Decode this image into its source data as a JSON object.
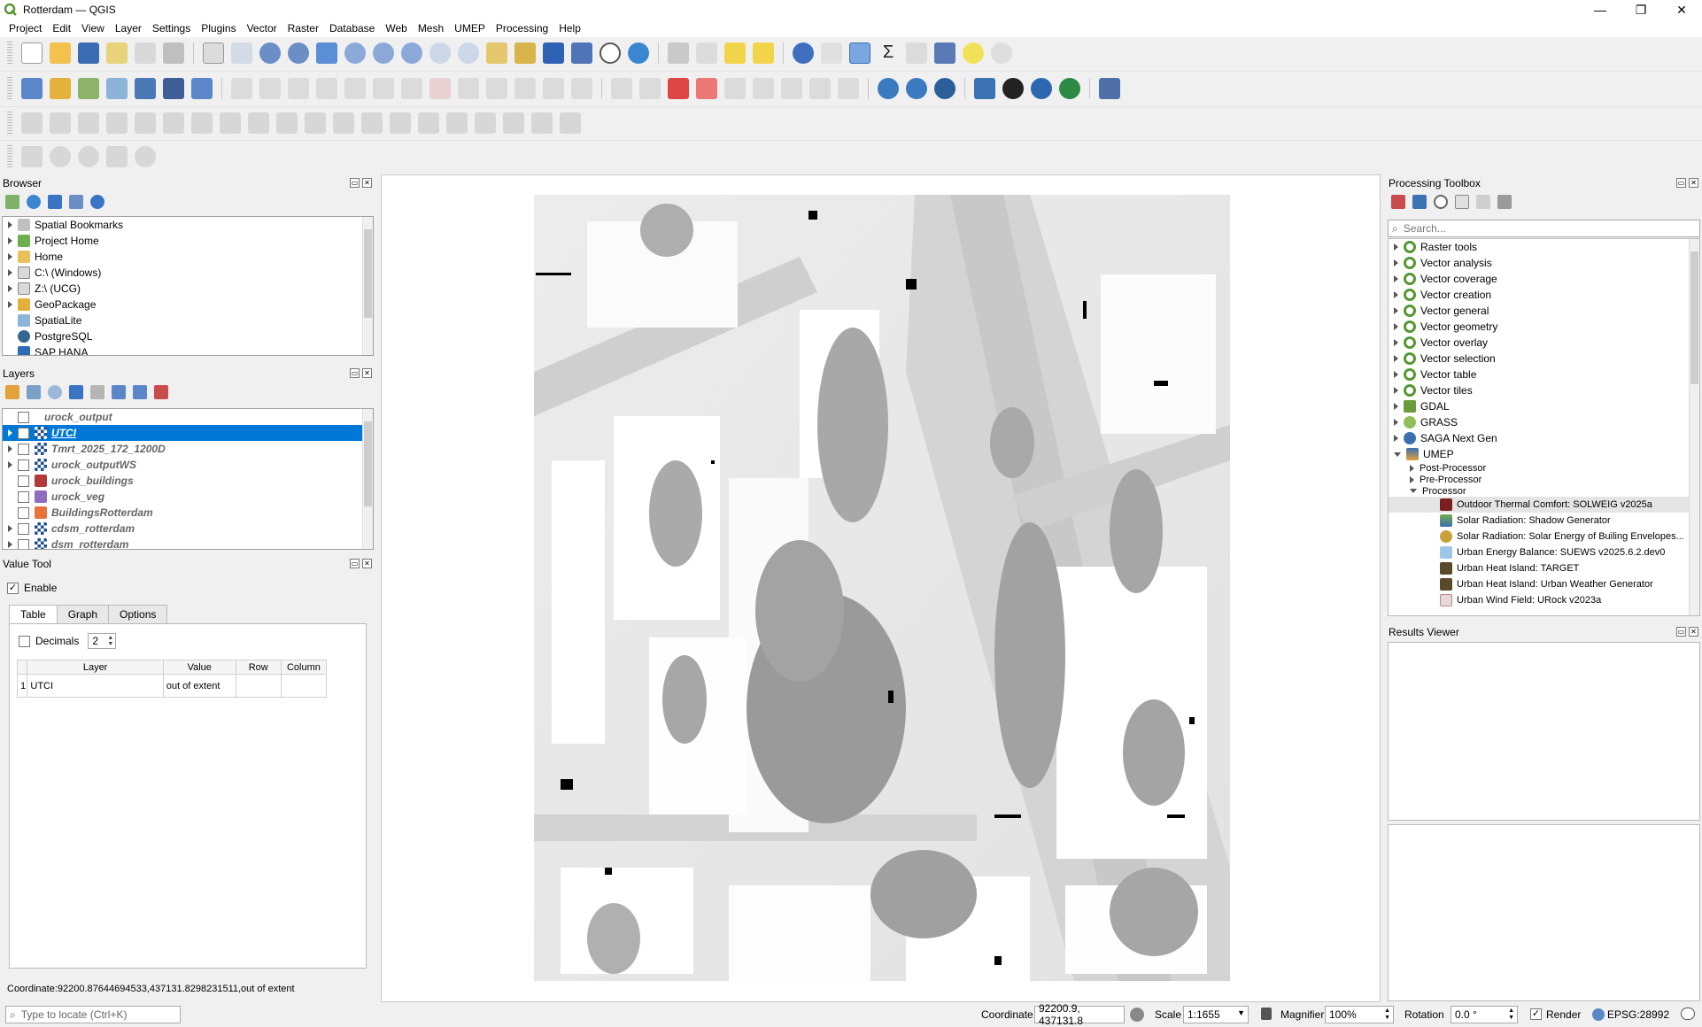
{
  "window": {
    "title": "Rotterdam — QGIS",
    "minimize": "—",
    "maximize": "❐",
    "close": "✕"
  },
  "menu": [
    "Project",
    "Edit",
    "View",
    "Layer",
    "Settings",
    "Plugins",
    "Vector",
    "Raster",
    "Database",
    "Web",
    "Mesh",
    "UMEP",
    "Processing",
    "Help"
  ],
  "browser": {
    "title": "Browser",
    "items": [
      "Spatial Bookmarks",
      "Project Home",
      "Home",
      "C:\\ (Windows)",
      "Z:\\ (UCG)",
      "GeoPackage",
      "SpatiaLite",
      "PostgreSQL",
      "SAP HANA"
    ]
  },
  "layers": {
    "title": "Layers",
    "items": [
      "urock_output",
      "UTCI",
      "Tmrt_2025_172_1200D",
      "urock_outputWS",
      "urock_buildings",
      "urock_veg",
      "BuildingsRotterdam",
      "cdsm_rotterdam",
      "dsm_rotterdam"
    ]
  },
  "value_tool": {
    "title": "Value Tool",
    "enable_label": "Enable",
    "tabs": [
      "Table",
      "Graph",
      "Options"
    ],
    "decimals_label": "Decimals",
    "decimals_value": "2",
    "columns": [
      "Layer",
      "Value",
      "Row",
      "Column"
    ],
    "row_index": "1",
    "row_layer": "UTCI",
    "row_value": "out of extent",
    "coordinate_readout": "Coordinate:92200.87644694533,437131.8298231511,out of extent"
  },
  "processing": {
    "title": "Processing Toolbox",
    "search_placeholder": "Search...",
    "groups": [
      "Raster tools",
      "Vector analysis",
      "Vector coverage",
      "Vector creation",
      "Vector general",
      "Vector geometry",
      "Vector overlay",
      "Vector selection",
      "Vector table",
      "Vector tiles",
      "GDAL",
      "GRASS",
      "SAGA Next Gen",
      "UMEP"
    ],
    "umep_children": [
      "Post-Processor",
      "Pre-Processor",
      "Processor"
    ],
    "processor_tools": [
      "Outdoor Thermal Comfort: SOLWEIG v2025a",
      "Solar Radiation: Shadow Generator",
      "Solar Radiation: Solar Energy of Builing Envelopes...",
      "Urban Energy Balance: SUEWS v2025.6.2.dev0",
      "Urban Heat Island: TARGET",
      "Urban Heat Island: Urban Weather Generator",
      "Urban Wind Field: URock v2023a"
    ]
  },
  "results_viewer": {
    "title": "Results Viewer"
  },
  "statusbar": {
    "locate_placeholder": "Type to locate (Ctrl+K)",
    "coordinate_label": "Coordinate",
    "coordinate_value": "92200.9, 437131.8",
    "scale_label": "Scale",
    "scale_value": "1:1655",
    "magnifier_label": "Magnifier",
    "magnifier_value": "100%",
    "rotation_label": "Rotation",
    "rotation_value": "0.0 °",
    "render_label": "Render",
    "crs": "EPSG:28992"
  },
  "colors": {
    "selection": "#0078d7",
    "qgis_green": "#589632",
    "panel_bg": "#f0f0f0"
  }
}
